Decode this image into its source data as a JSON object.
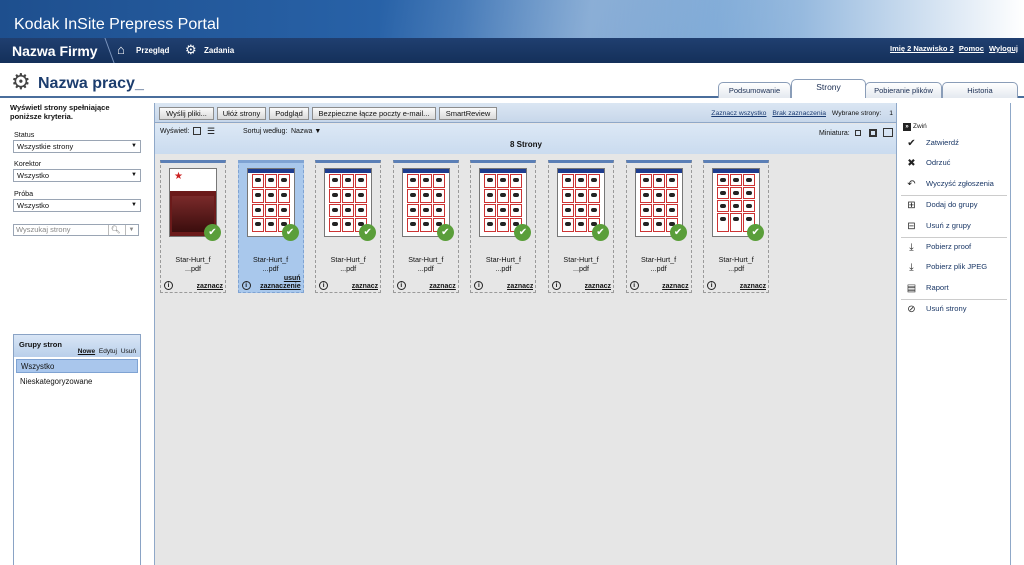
{
  "app": {
    "title": "Kodak InSite Prepress Portal"
  },
  "nav": {
    "company": "Nazwa Firmy",
    "overview": "Przegląd",
    "tasks": "Zadania",
    "user": "Imię 2 Nazwisko 2",
    "help": "Pomoc",
    "logout": "Wyloguj"
  },
  "job": {
    "title": "Nazwa pracy_"
  },
  "tabs": [
    "Podsumowanie",
    "Strony",
    "Pobieranie plików",
    "Historia"
  ],
  "left": {
    "criteria": "Wyświetl strony spełniające poniższe kryteria.",
    "status_label": "Status",
    "status_value": "Wszystkie strony",
    "corrector_label": "Korektor",
    "corrector_value": "Wszystko",
    "proof_label": "Próba",
    "proof_value": "Wszystko",
    "search_placeholder": "Wyszukaj strony",
    "groups": {
      "title": "Grupy stron",
      "new": "Nowe",
      "edit": "Edytuj",
      "delete": "Usuń",
      "items": [
        "Wszystko",
        "Nieskategoryzowane"
      ]
    }
  },
  "toolbar": {
    "send": "Wyślij pliki...",
    "arrange": "Ułóż strony",
    "preview": "Podgląd",
    "secure_link": "Bezpieczne łącze poczty e-mail...",
    "smartreview": "SmartReview",
    "select_all": "Zaznacz wszystko",
    "select_none": "Brak zaznaczenia",
    "selected_label": "Wybrane strony:",
    "selected_count": "1"
  },
  "viewbar": {
    "display": "Wyświetl:",
    "sort_label": "Sortuj według:",
    "sort_value": "Nazwa",
    "thumbnail": "Miniatura:",
    "page_count": "8 Strony"
  },
  "pages": [
    {
      "name": "Star-Hurt_f ...pdf",
      "selected": false,
      "action": "zaznacz",
      "kind": "cover"
    },
    {
      "name": "Star-Hurt_f ...pdf",
      "selected": true,
      "action": "usuń zaznaczenie",
      "kind": "grid"
    },
    {
      "name": "Star-Hurt_f ...pdf",
      "selected": false,
      "action": "zaznacz",
      "kind": "grid"
    },
    {
      "name": "Star-Hurt_f ...pdf",
      "selected": false,
      "action": "zaznacz",
      "kind": "grid"
    },
    {
      "name": "Star-Hurt_f ...pdf",
      "selected": false,
      "action": "zaznacz",
      "kind": "grid"
    },
    {
      "name": "Star-Hurt_f ...pdf",
      "selected": false,
      "action": "zaznacz",
      "kind": "grid"
    },
    {
      "name": "Star-Hurt_f ...pdf",
      "selected": false,
      "action": "zaznacz",
      "kind": "grid"
    },
    {
      "name": "Star-Hurt_f ...pdf",
      "selected": false,
      "action": "zaznacz",
      "kind": "alt"
    }
  ],
  "right": {
    "collapse": "Zwiń",
    "actions": [
      "Zatwierdź",
      "Odrzuć",
      "Wyczyść zgłoszenia",
      "Dodaj do grupy",
      "Usuń z grupy",
      "Pobierz proof",
      "Pobierz plik JPEG",
      "Raport",
      "Usuń strony"
    ]
  }
}
